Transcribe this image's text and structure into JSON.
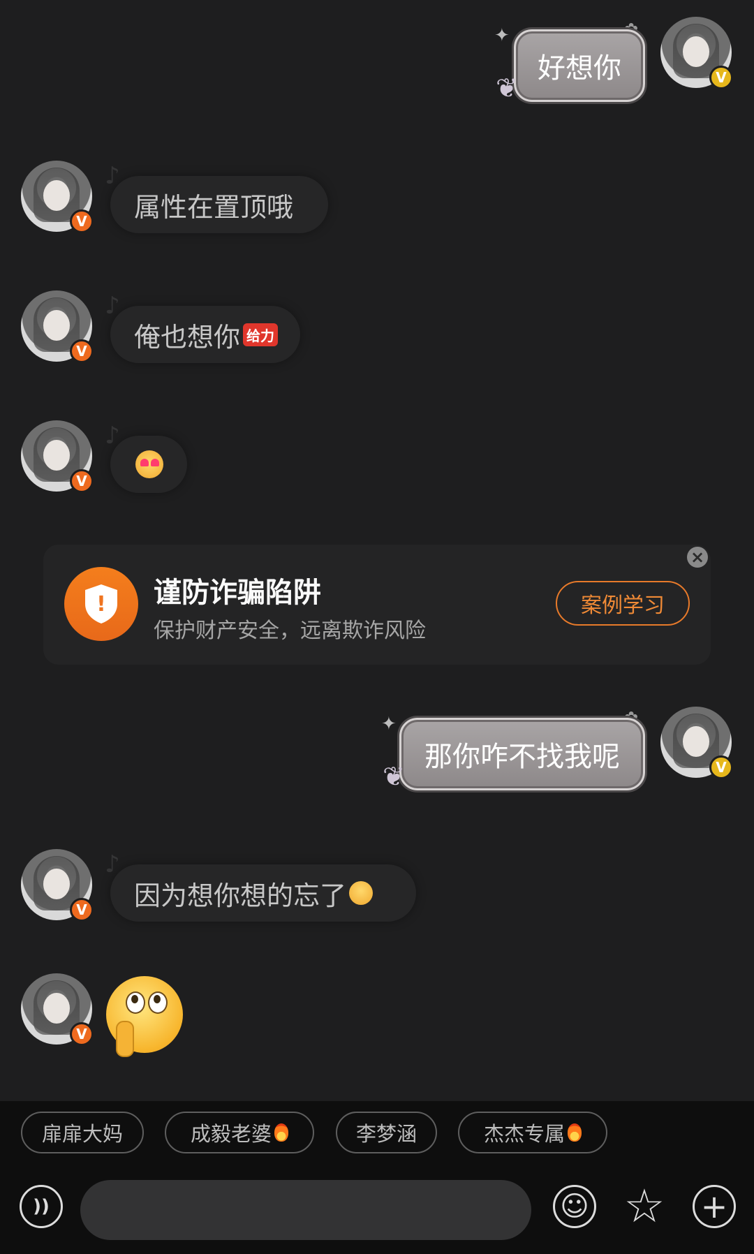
{
  "messages": [
    {
      "side": "right",
      "text": "好想你"
    },
    {
      "side": "left",
      "text": "属性在置顶哦"
    },
    {
      "side": "left",
      "text": "俺也想你"
    },
    {
      "side": "left",
      "emoji": "heart-eyes-emoji"
    },
    {
      "side": "right",
      "text": "那你咋不找我呢"
    },
    {
      "side": "left",
      "text": "因为想你想的忘了"
    },
    {
      "side": "left",
      "emoji": "shush-emoji"
    }
  ],
  "badge_inline": "给力",
  "badge_letter": "V",
  "warning": {
    "title": "谨防诈骗陷阱",
    "subtitle": "保护财产安全，远离欺诈风险",
    "button": "案例学习",
    "close": "×",
    "icon_glyph": "!"
  },
  "quick_replies": [
    "扉扉大妈",
    "成毅老婆",
    "李梦涵",
    "杰杰专属"
  ],
  "input": {
    "placeholder": ""
  },
  "toolbar": {
    "voice_icon": "voice-icon",
    "emoji_icon": "emoji-icon",
    "sticker_icon": "star-sticker-icon",
    "plus_icon": "plus-icon",
    "voice_glyph": "))",
    "emoji_glyph": "☺",
    "star_glyph": "☆",
    "plus_glyph": "+"
  },
  "colors": {
    "accent": "#ee6a1f",
    "background": "#1e1e1f",
    "bubble_right": "#9b9697"
  }
}
